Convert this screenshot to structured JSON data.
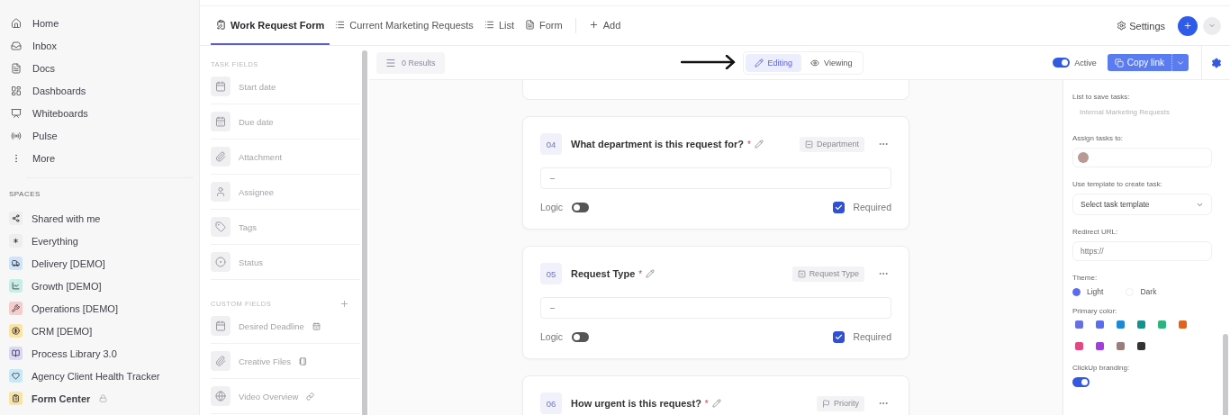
{
  "sidebar": {
    "nav": [
      {
        "label": "Home"
      },
      {
        "label": "Inbox"
      },
      {
        "label": "Docs"
      },
      {
        "label": "Dashboards"
      },
      {
        "label": "Whiteboards"
      },
      {
        "label": "Pulse"
      },
      {
        "label": "More"
      }
    ],
    "spaces_heading": "SPACES",
    "spaces": [
      {
        "label": "Shared with me",
        "color": "#eeeeee"
      },
      {
        "label": "Everything",
        "color": "#eeeeee"
      },
      {
        "label": "Delivery [DEMO]",
        "color": "#cfe3fb"
      },
      {
        "label": "Growth [DEMO]",
        "color": "#c8ece6"
      },
      {
        "label": "Operations [DEMO]",
        "color": "#f6cccc"
      },
      {
        "label": "CRM [DEMO]",
        "color": "#fbe3a6"
      },
      {
        "label": "Process Library 3.0",
        "color": "#dcd7f7"
      },
      {
        "label": "Agency Client Health Tracker",
        "color": "#c9e8f7"
      },
      {
        "label": "Form Center",
        "color": "#fbe3a6",
        "locked": true
      }
    ]
  },
  "tabs": [
    {
      "label": "Work Request Form",
      "selected": true
    },
    {
      "label": "Current Marketing Requests",
      "selected": false
    },
    {
      "label": "List",
      "selected": false
    },
    {
      "label": "Form",
      "selected": false
    }
  ],
  "add_view": "Add",
  "settings": "Settings",
  "field_panel": {
    "task_heading": "TASK FIELDS",
    "task_fields": [
      {
        "label": "Start date"
      },
      {
        "label": "Due date"
      },
      {
        "label": "Attachment"
      },
      {
        "label": "Assignee"
      },
      {
        "label": "Tags"
      },
      {
        "label": "Status"
      }
    ],
    "custom_heading": "CUSTOM FIELDS",
    "custom_fields": [
      {
        "label": "Desired Deadline"
      },
      {
        "label": "Creative Files"
      },
      {
        "label": "Video Overview"
      }
    ]
  },
  "toolbar": {
    "results": "0 Results",
    "modes": [
      {
        "label": "Editing",
        "selected": true
      },
      {
        "label": "Viewing",
        "selected": false
      }
    ],
    "active": {
      "label": "Active",
      "on": true
    },
    "copy_link": "Copy link"
  },
  "questions": [
    {
      "number": "04",
      "text": "What department is this request for?",
      "mark": "*",
      "field_type": "Department",
      "value": "–",
      "logic_label": "Logic",
      "logic": false,
      "required_label": "Required",
      "required": true
    },
    {
      "number": "05",
      "text": "Request Type",
      "mark": "*",
      "field_type": "Request Type",
      "value": "–",
      "logic_label": "Logic",
      "logic": false,
      "required_label": "Required",
      "required": true
    },
    {
      "number": "06",
      "text": "How urgent is this request?",
      "mark": "*",
      "field_type": "Priority"
    }
  ],
  "settings_panel": {
    "list_label": "List to save tasks:",
    "list_value": "Internal Marketing Requests",
    "assign_label": "Assign tasks to:",
    "template_label": "Use template to create task:",
    "template_select": "Select task template",
    "redirect_label": "Redirect URL:",
    "redirect_placeholder": "https://",
    "theme_label": "Theme:",
    "themes": [
      {
        "label": "Light",
        "selected": true
      },
      {
        "label": "Dark",
        "selected": false
      }
    ],
    "color_label": "Primary color:",
    "colors": [
      {
        "color": "#6670e0"
      },
      {
        "color": "#5b6cf0"
      },
      {
        "color": "#1f88d4"
      },
      {
        "color": "#15938a"
      },
      {
        "color": "#2fb37a"
      },
      {
        "color": "#e0651c"
      },
      {
        "color": "#e04a80"
      },
      {
        "color": "#a140d8"
      },
      {
        "color": "#9a7d7d"
      },
      {
        "color": "#333333"
      }
    ],
    "branding_label": "ClickUp branding:",
    "branding": true
  }
}
